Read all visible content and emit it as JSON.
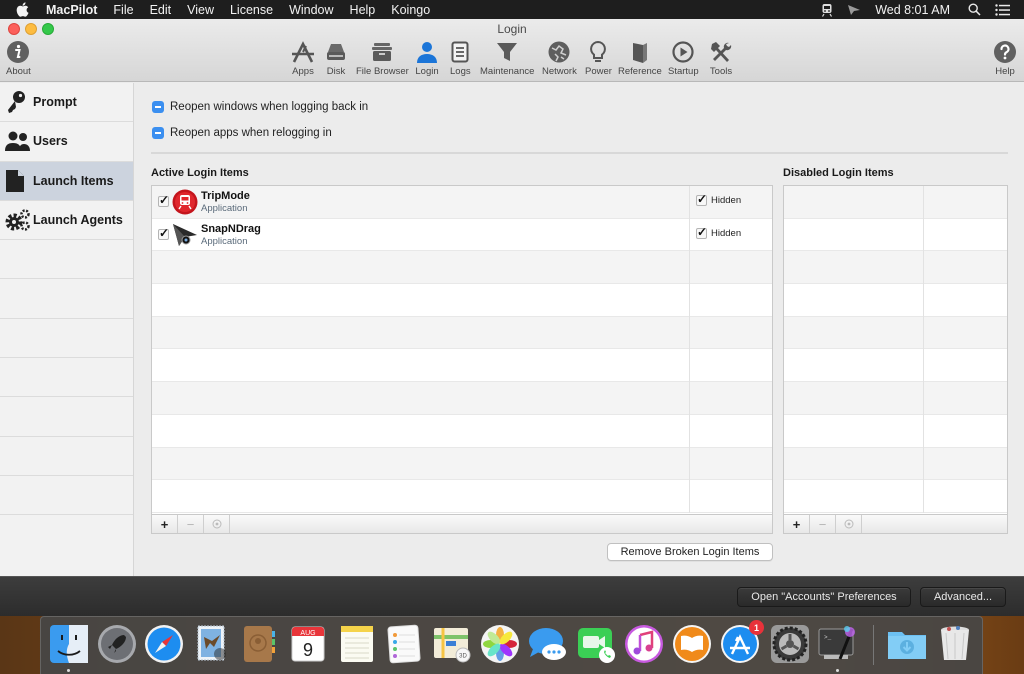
{
  "menubar": {
    "app_name": "MacPilot",
    "menus": [
      "File",
      "Edit",
      "View",
      "License",
      "Window",
      "Help",
      "Koingo"
    ],
    "status_icons": [
      "tripmode-icon",
      "snapndrag-icon"
    ],
    "clock": "Wed 8:01 AM"
  },
  "window": {
    "title": "Login",
    "toolbar": {
      "about": "About",
      "items": [
        {
          "id": "apps",
          "label": "Apps",
          "icon": "app-store-icon"
        },
        {
          "id": "disk",
          "label": "Disk",
          "icon": "disk-icon"
        },
        {
          "id": "file-browser",
          "label": "File Browser",
          "icon": "file-cabinet-icon"
        },
        {
          "id": "login",
          "label": "Login",
          "icon": "user-icon",
          "active": true
        },
        {
          "id": "logs",
          "label": "Logs",
          "icon": "document-lines-icon"
        },
        {
          "id": "maintenance",
          "label": "Maintenance",
          "icon": "funnel-icon"
        },
        {
          "id": "network",
          "label": "Network",
          "icon": "globe-icon"
        },
        {
          "id": "power",
          "label": "Power",
          "icon": "lightbulb-icon"
        },
        {
          "id": "reference",
          "label": "Reference",
          "icon": "book-icon"
        },
        {
          "id": "startup",
          "label": "Startup",
          "icon": "play-circle-icon"
        },
        {
          "id": "tools",
          "label": "Tools",
          "icon": "hammer-wrench-icon"
        }
      ],
      "help": "Help"
    },
    "accent_color": "#1b75d8"
  },
  "sidebar": {
    "items": [
      {
        "label": "Prompt",
        "icon": "key-icon"
      },
      {
        "label": "Users",
        "icon": "users-icon"
      },
      {
        "label": "Launch Items",
        "icon": "document-icon",
        "selected": true
      },
      {
        "label": "Launch Agents",
        "icon": "gears-icon"
      }
    ]
  },
  "main": {
    "options": [
      {
        "label": "Reopen windows when logging back in",
        "state": "mixed"
      },
      {
        "label": "Reopen apps when relogging in",
        "state": "mixed"
      }
    ],
    "active_title": "Active Login Items",
    "disabled_title": "Disabled Login Items",
    "active_items": [
      {
        "name": "TripMode",
        "kind": "Application",
        "enabled": true,
        "hidden": true,
        "hidden_label": "Hidden"
      },
      {
        "name": "SnapNDrag",
        "kind": "Application",
        "enabled": true,
        "hidden": true,
        "hidden_label": "Hidden"
      }
    ],
    "disabled_items": [],
    "footer_buttons": {
      "add": "+",
      "remove": "−",
      "reveal": "reveal-icon"
    },
    "remove_broken_label": "Remove Broken Login Items"
  },
  "bottombar": {
    "open_accounts_label": "Open \"Accounts\" Preferences",
    "advanced_label": "Advanced..."
  },
  "dock": {
    "apps": [
      "Finder",
      "Launchpad",
      "Safari",
      "Mail",
      "Contacts",
      "Calendar",
      "Notes",
      "Reminders",
      "Maps",
      "Photos",
      "Messages",
      "FaceTime",
      "iTunes",
      "iBooks",
      "App Store",
      "System Preferences",
      "MacPilot",
      "Downloads",
      "Trash"
    ],
    "calendar_month": "AUG",
    "calendar_day": "9",
    "app_store_badge": "1",
    "running": [
      "Finder",
      "MacPilot"
    ]
  }
}
